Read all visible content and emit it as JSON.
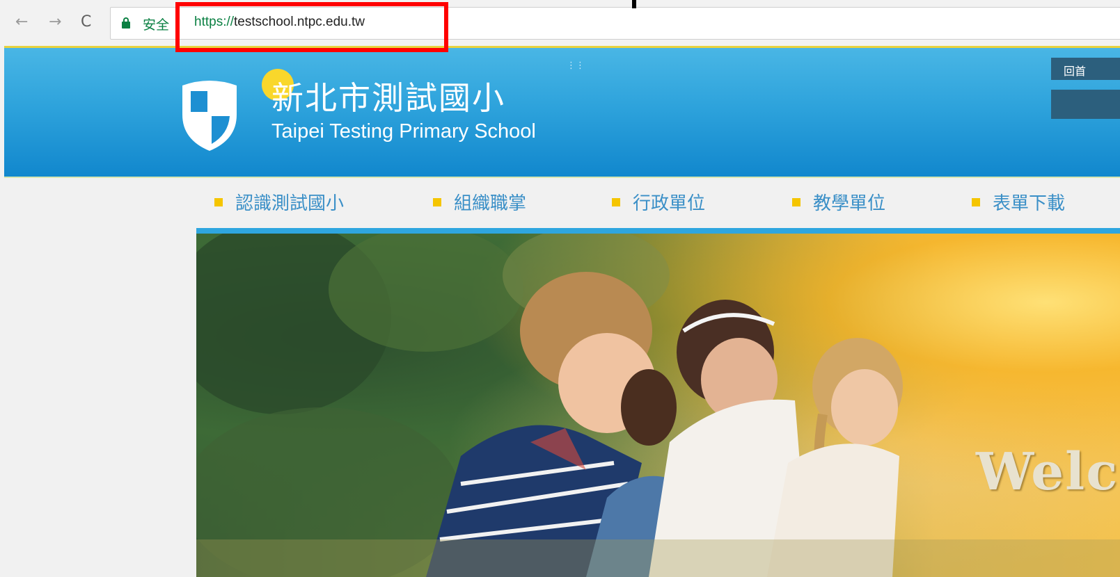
{
  "browser": {
    "back_icon": "←",
    "forward_icon": "→",
    "reload_icon": "C",
    "secure_label": "安全",
    "url_protocol": "https://",
    "url_host": "testschool.ntpc.edu.tw"
  },
  "header": {
    "school_name": "新北市測試國小",
    "school_name_en": "Taipei Testing Primary School",
    "dots": "⋮⋮",
    "home_link": "回首",
    "colors": {
      "header_top": "#49b6e5",
      "header_bottom": "#1187cd",
      "accent": "#f9d72b"
    }
  },
  "nav": {
    "items": [
      {
        "label": "認識測試國小"
      },
      {
        "label": "組織職掌"
      },
      {
        "label": "行政單位"
      },
      {
        "label": "教學單位"
      },
      {
        "label": "表單下載"
      }
    ]
  },
  "banner": {
    "welcome_text": "Welc"
  },
  "annotation": {
    "color": "#ff0000"
  }
}
